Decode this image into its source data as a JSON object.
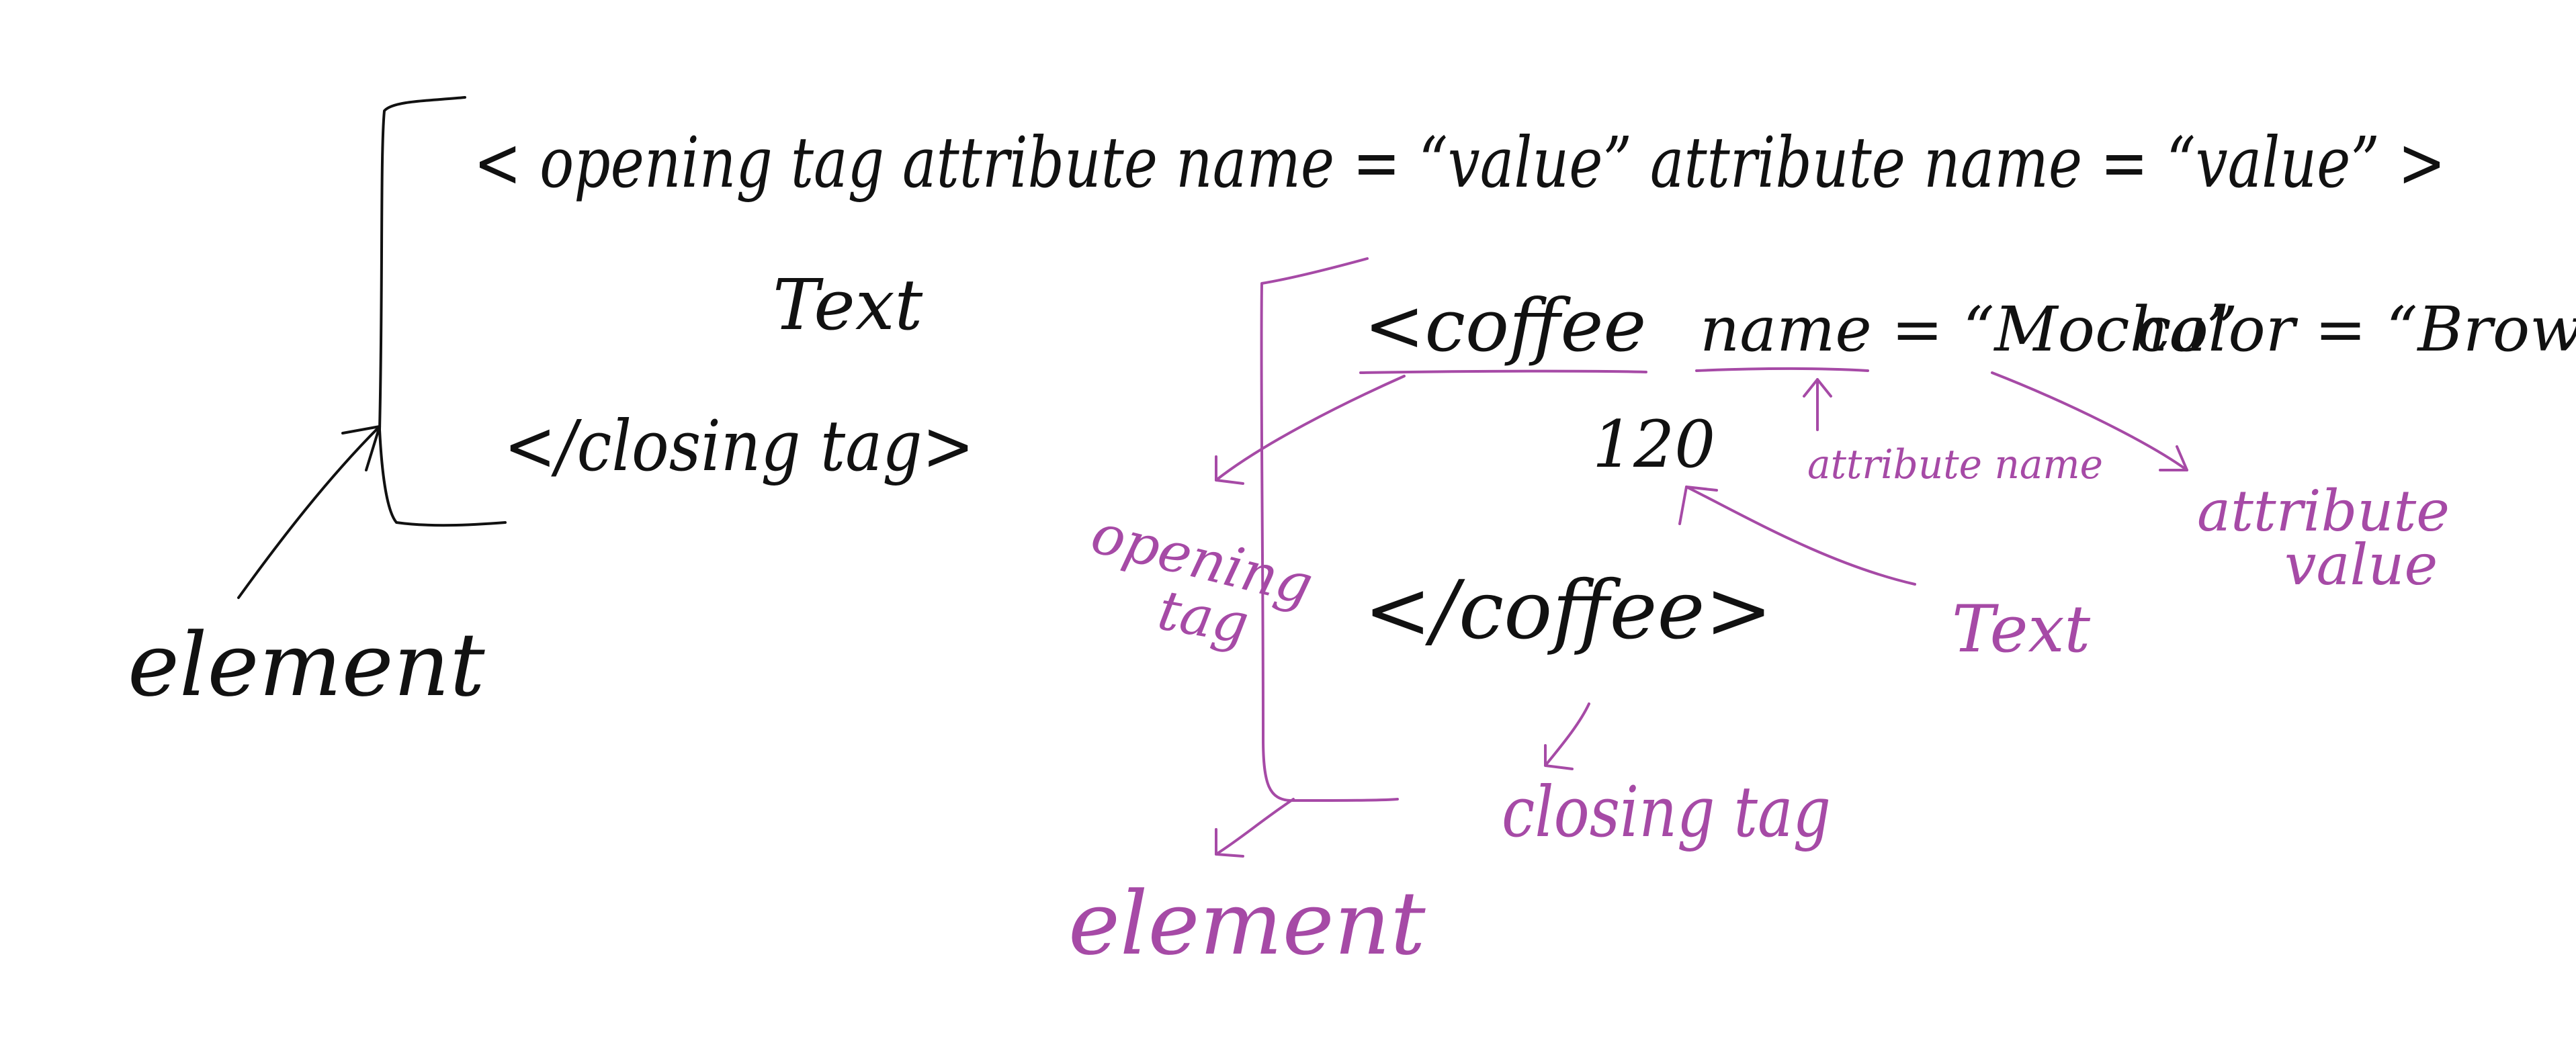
{
  "colors": {
    "background": "#ffffff",
    "black_ink": "#111111",
    "purple_ink": "#a64aa6"
  },
  "generic": {
    "opening_tag": "< opening tag attribute name = “value” attribute name = “value” >",
    "text": "Text",
    "closing_tag": "</closing tag>",
    "element_label": "element"
  },
  "example": {
    "opening_tag_name": "<coffee",
    "attr1": "name = “Mocha”",
    "attr2": "color = “Brown” >",
    "text_value": "120",
    "closing_tag": "</coffee>"
  },
  "annotations": {
    "opening_tag": [
      "opening",
      "tag"
    ],
    "attribute_name": "attribute name",
    "attribute_value": [
      "attribute",
      "value"
    ],
    "text": "Text",
    "closing_tag": "closing tag",
    "element": "element"
  }
}
